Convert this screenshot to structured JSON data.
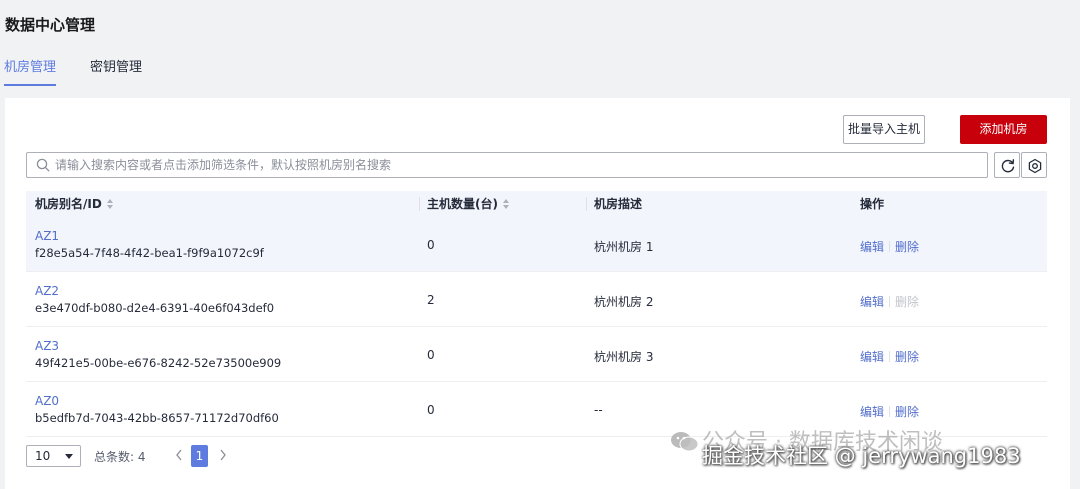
{
  "page": {
    "title": "数据中心管理"
  },
  "tabs": [
    {
      "label": "机房管理",
      "active": true
    },
    {
      "label": "密钥管理",
      "active": false
    }
  ],
  "toolbar": {
    "import_label": "批量导入主机",
    "add_label": "添加机房"
  },
  "search": {
    "placeholder": "请输入搜索内容或者点击添加筛选条件，默认按照机房别名搜索",
    "value": ""
  },
  "table": {
    "headers": {
      "name": "机房别名/ID",
      "count": "主机数量(台)",
      "desc": "机房描述",
      "ops": "操作"
    },
    "rows": [
      {
        "name": "AZ1",
        "id": "f28e5a54-7f48-4f42-bea1-f9f9a1072c9f",
        "count": "0",
        "desc": "杭州机房 1",
        "edit": "编辑",
        "delete": "删除",
        "delete_enabled": true
      },
      {
        "name": "AZ2",
        "id": "e3e470df-b080-d2e4-6391-40e6f043def0",
        "count": "2",
        "desc": "杭州机房 2",
        "edit": "编辑",
        "delete": "删除",
        "delete_enabled": false
      },
      {
        "name": "AZ3",
        "id": "49f421e5-00be-e676-8242-52e73500e909",
        "count": "0",
        "desc": "杭州机房 3",
        "edit": "编辑",
        "delete": "删除",
        "delete_enabled": true
      },
      {
        "name": "AZ0",
        "id": "b5edfb7d-7043-42bb-8657-71172d70df60",
        "count": "0",
        "desc": "--",
        "edit": "编辑",
        "delete": "删除",
        "delete_enabled": true
      }
    ]
  },
  "pagination": {
    "page_size": "10",
    "total_label": "总条数: 4",
    "current_page": "1"
  },
  "watermark": {
    "line1": "公众号 · 数据库技术闲谈",
    "line2": "掘金技术社区 @ jerrywang1983"
  },
  "colors": {
    "accent": "#5e7ce0",
    "primary_button": "#c7000b",
    "link": "#526ecc",
    "header_bg": "#f2f5fc"
  }
}
